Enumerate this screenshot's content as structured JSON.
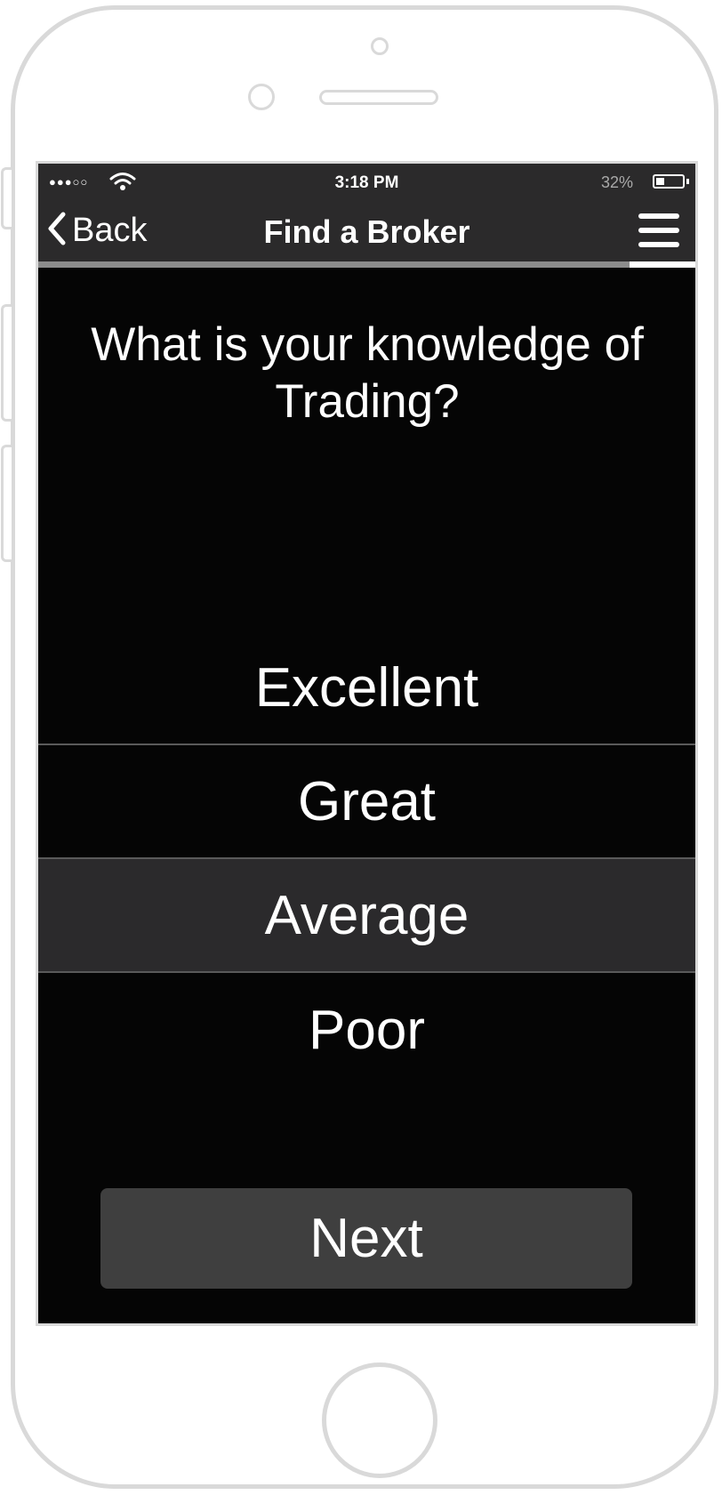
{
  "statusbar": {
    "signal": "●●●○○",
    "time": "3:18 PM",
    "battery_pct": "32%",
    "battery_level": 0.32
  },
  "navbar": {
    "back_label": "Back",
    "title": "Find a Broker"
  },
  "progress": {
    "start": 0.9,
    "end": 1.0
  },
  "question": "What is your knowledge of Trading?",
  "options": [
    {
      "label": "Excellent",
      "selected": false
    },
    {
      "label": "Great",
      "selected": false
    },
    {
      "label": "Average",
      "selected": true
    },
    {
      "label": "Poor",
      "selected": false
    }
  ],
  "next_label": "Next",
  "colors": {
    "screen_bg": "#050505",
    "bar_bg": "#2b2a2b",
    "selected_bg": "#2b2a2c",
    "button_bg": "#3f3f3f",
    "frame": "#d9d9d9"
  }
}
